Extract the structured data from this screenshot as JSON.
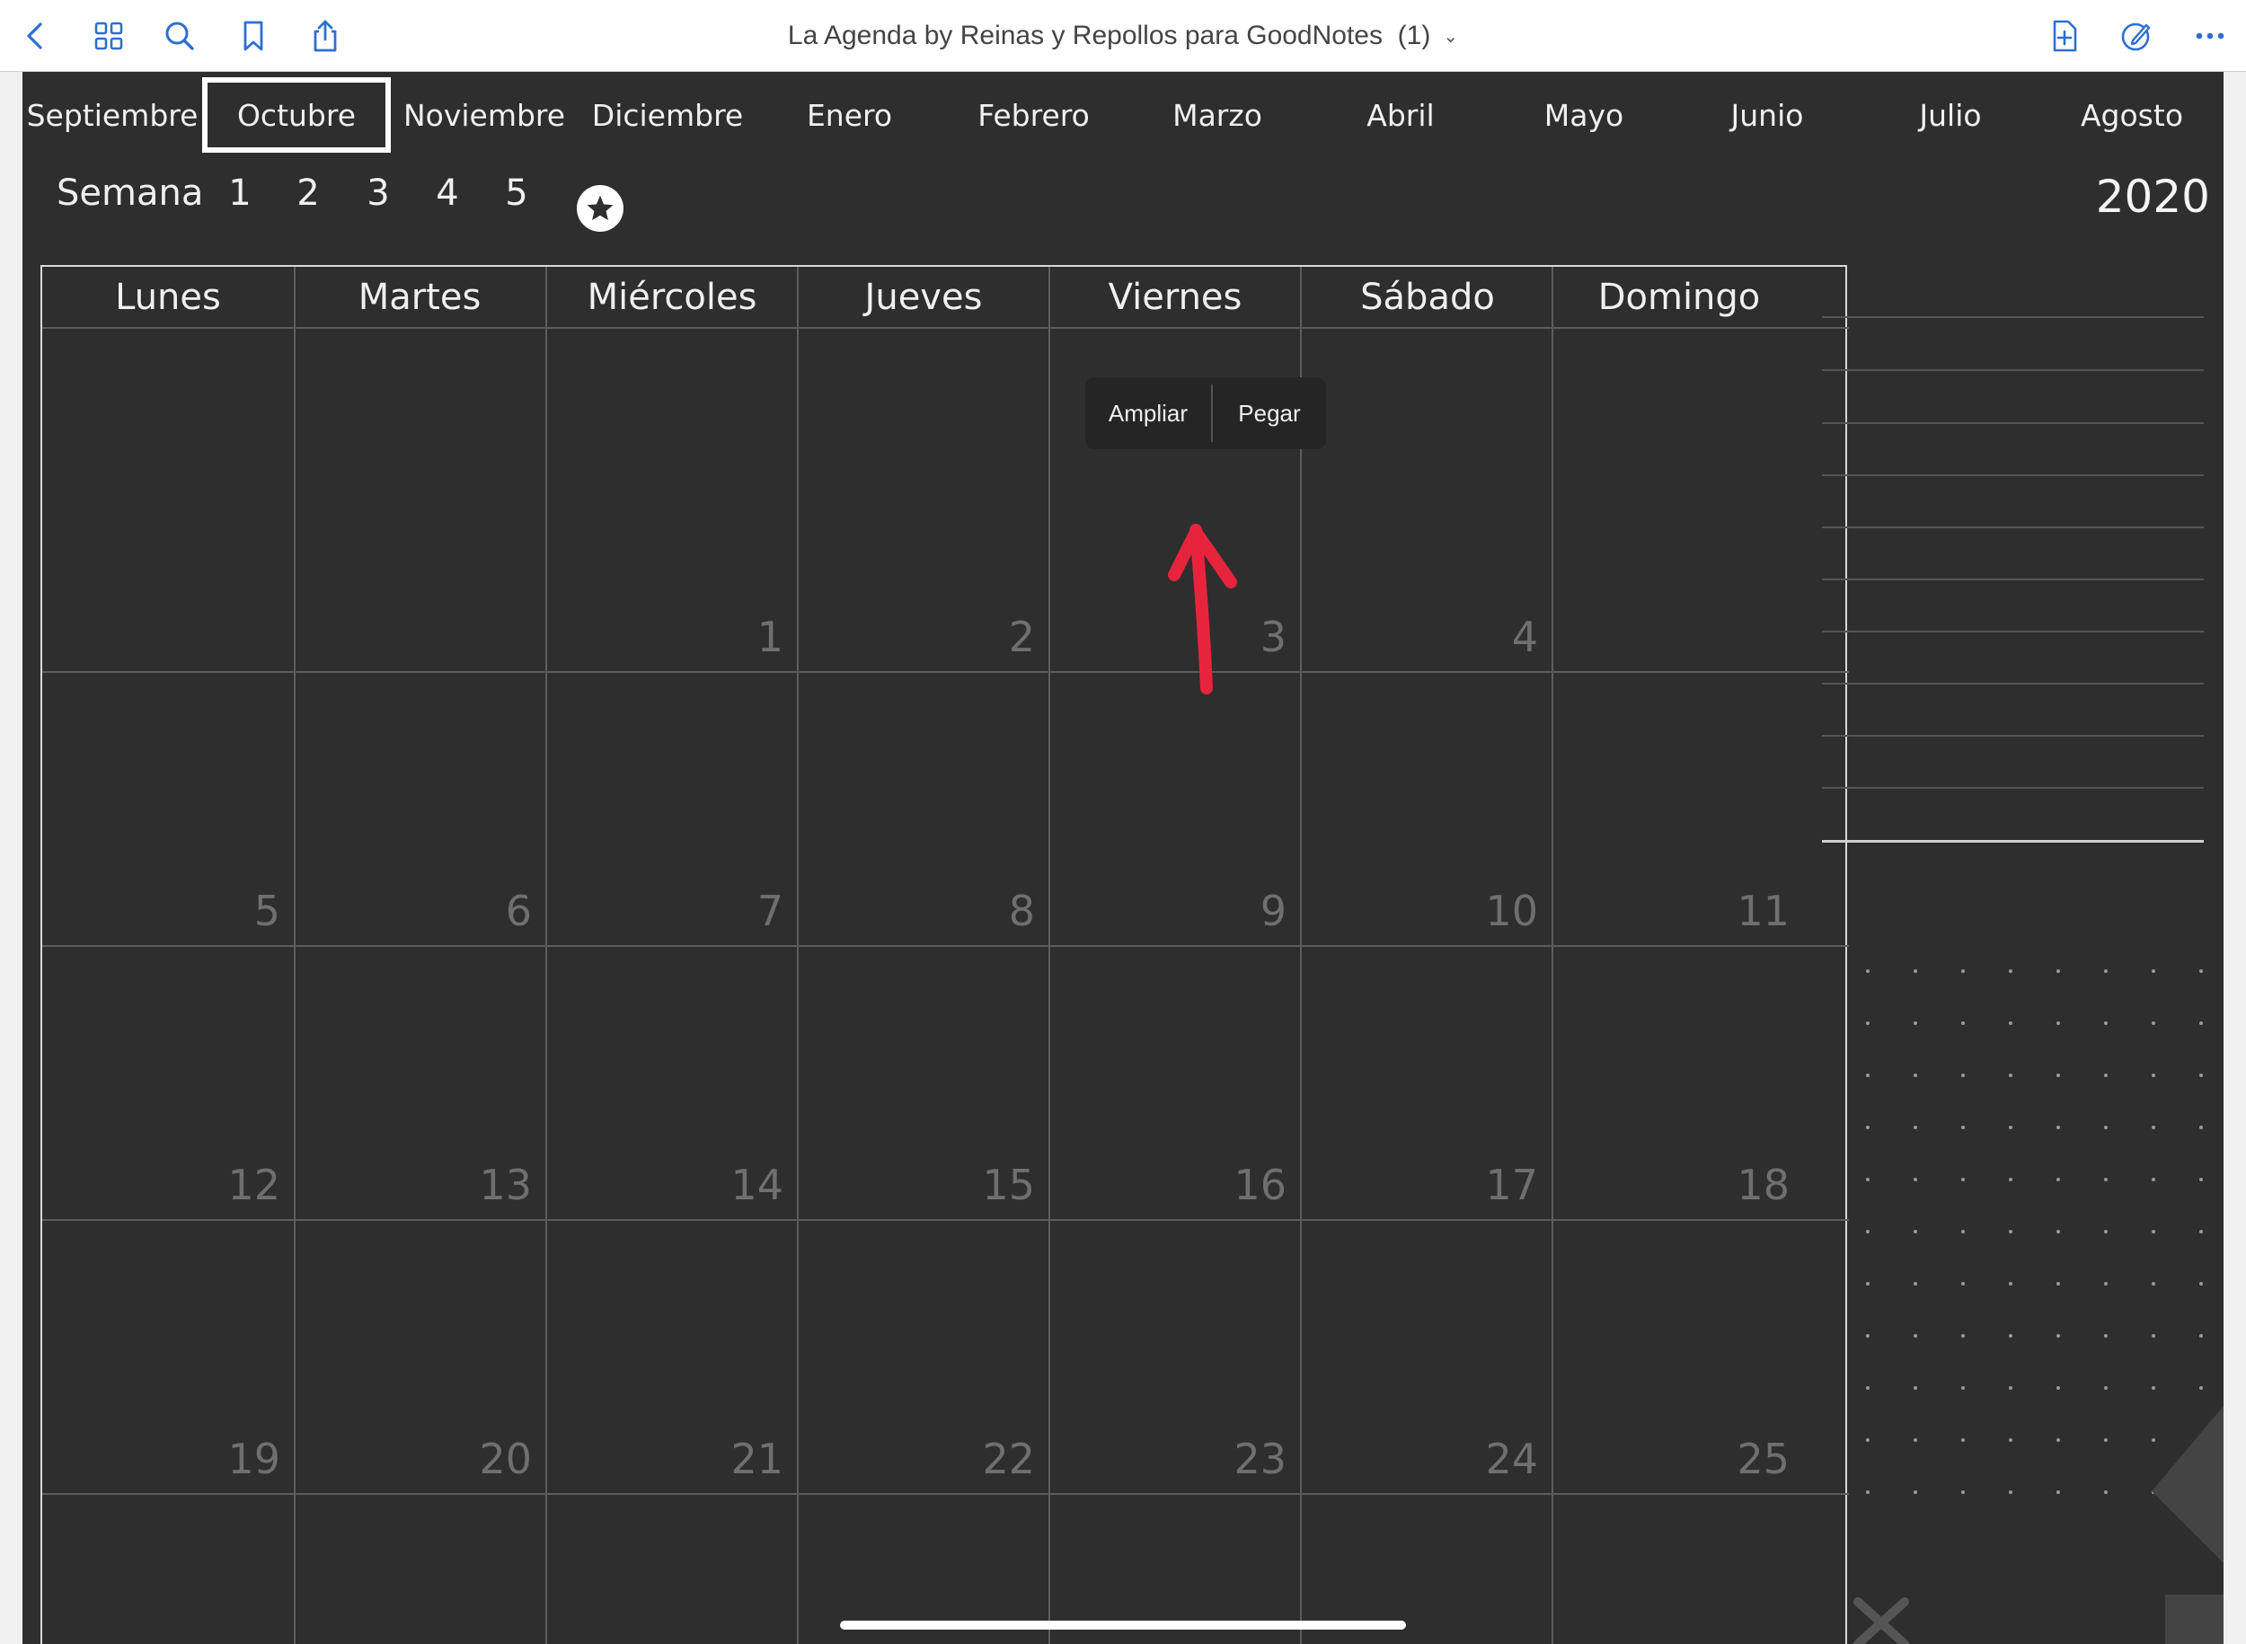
{
  "toolbar": {
    "title": "La Agenda by Reinas y Repollos para GoodNotes  (1)",
    "title_chevron": "chevron-down-icon",
    "left_icons": [
      "back-icon",
      "grid-icon",
      "search-icon",
      "bookmark-icon",
      "share-icon"
    ],
    "right_icons": [
      "add-page-icon",
      "pen-edit-icon",
      "more-icon"
    ],
    "accent": "#2d6fd1"
  },
  "months": [
    "Septiembre",
    "Octubre",
    "Noviembre",
    "Diciembre",
    "Enero",
    "Febrero",
    "Marzo",
    "Abril",
    "Mayo",
    "Junio",
    "Julio",
    "Agosto"
  ],
  "selected_month": "Octubre",
  "week_nav": {
    "label": "Semana",
    "numbers": [
      "1",
      "2",
      "3",
      "4",
      "5"
    ],
    "star_icon": "star-icon"
  },
  "year": "2020",
  "calendar": {
    "days": [
      "Lunes",
      "Martes",
      "Miércoles",
      "Jueves",
      "Viernes",
      "Sábado",
      "Domingo"
    ],
    "weeks": [
      [
        "",
        "",
        "",
        "1",
        "2",
        "3",
        "4"
      ],
      [
        "5",
        "6",
        "7",
        "8",
        "9",
        "10",
        "11"
      ],
      [
        "12",
        "13",
        "14",
        "15",
        "16",
        "17",
        "18"
      ],
      [
        "19",
        "20",
        "21",
        "22",
        "23",
        "24",
        "25"
      ]
    ]
  },
  "context_menu": {
    "items": [
      "Ampliar",
      "Pegar"
    ]
  },
  "annotation": {
    "arrow_color": "#e8243c"
  },
  "colors": {
    "page_bg": "#2e2e2e",
    "grid_line": "#5c5c5c",
    "day_number": "#6f6f6f"
  }
}
